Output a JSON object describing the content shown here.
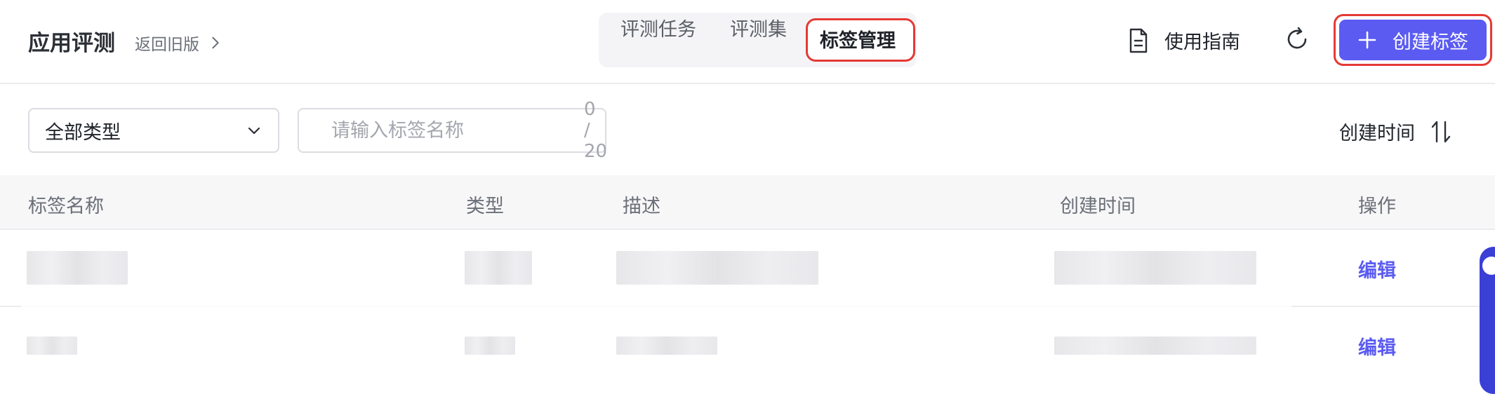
{
  "header": {
    "app_title": "应用评测",
    "back_old": "返回旧版",
    "tabs": [
      {
        "label": "评测任务"
      },
      {
        "label": "评测集"
      },
      {
        "label": "标签管理"
      }
    ],
    "guide_label": "使用指南",
    "create_label": "创建标签"
  },
  "filters": {
    "type_select_value": "全部类型",
    "search_placeholder": "请输入标签名称",
    "search_count": "0 / 20",
    "sort_label": "创建时间"
  },
  "table": {
    "columns": [
      "标签名称",
      "类型",
      "描述",
      "创建时间",
      "操作"
    ],
    "rows": [
      {
        "action": "编辑"
      },
      {
        "action": "编辑"
      }
    ]
  },
  "colors": {
    "accent": "#5b5bf2",
    "highlight_border": "#e53935"
  },
  "icons": [
    "chevron-right-icon",
    "document-icon",
    "refresh-icon",
    "plus-icon",
    "chevron-down-icon",
    "search-icon",
    "sort-icon"
  ]
}
